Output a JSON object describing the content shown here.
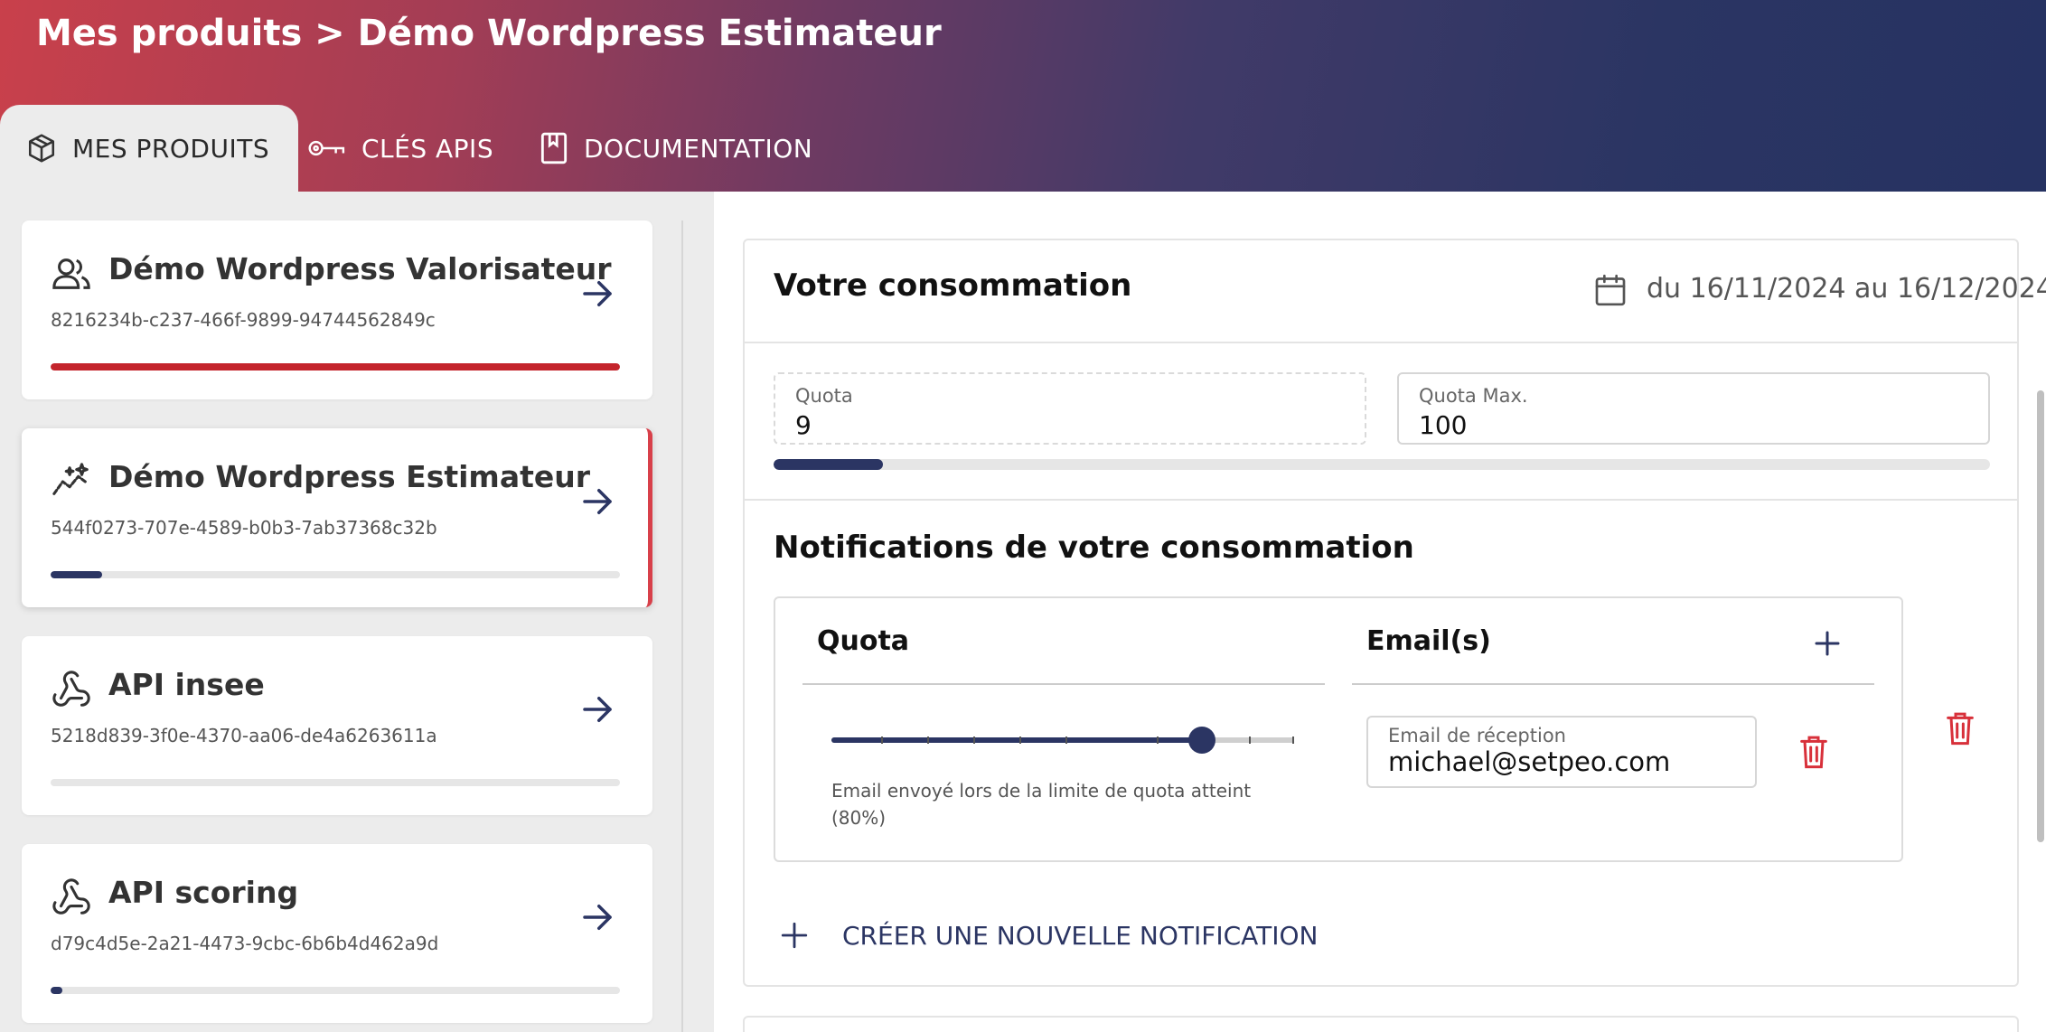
{
  "header": {
    "breadcrumb": "Mes produits > Démo Wordpress Estimateur"
  },
  "tabs": [
    {
      "label": "MES PRODUITS",
      "icon": "package-icon",
      "active": true
    },
    {
      "label": "CLÉS APIS",
      "icon": "key-icon",
      "active": false
    },
    {
      "label": "DOCUMENTATION",
      "icon": "book-icon",
      "active": false
    }
  ],
  "products": [
    {
      "name": "Démo Wordpress Valorisateur",
      "id": "8216234b-c237-466f-9899-94744562849c",
      "icon": "users-icon",
      "usage": 1.0,
      "bar_color": "#c4242c",
      "selected": false
    },
    {
      "name": "Démo Wordpress Estimateur",
      "id": "544f0273-707e-4589-b0b3-7ab37368c32b",
      "icon": "sparkle-chart-icon",
      "usage": 0.09,
      "bar_color": "#2b3563",
      "selected": true
    },
    {
      "name": "API insee",
      "id": "5218d839-3f0e-4370-aa06-de4a6263611a",
      "icon": "webhook-icon",
      "usage": 0,
      "bar_color": "#2b3563",
      "selected": false
    },
    {
      "name": "API scoring",
      "id": "d79c4d5e-2a21-4473-9cbc-6b6b4d462a9d",
      "icon": "webhook-icon",
      "usage": 0.02,
      "bar_color": "#2b3563",
      "selected": false
    }
  ],
  "consumption": {
    "title": "Votre consommation",
    "date_range": "du 16/11/2024 au 16/12/2024",
    "quota_label": "Quota",
    "quota_value": "9",
    "quota_max_label": "Quota Max.",
    "quota_max_value": "100",
    "usage_fraction": 0.09
  },
  "notifications": {
    "title": "Notifications de votre consommation",
    "col_quota": "Quota",
    "col_emails": "Email(s)",
    "rows": [
      {
        "threshold_percent": 80,
        "caption": "Email envoyé lors de la limite de quota atteint (80%)",
        "email_label": "Email de réception",
        "email_value": "michael@setpeo.com"
      }
    ],
    "create_label": "CRÉER UNE NOUVELLE NOTIFICATION"
  },
  "colors": {
    "accent": "#2b3563",
    "danger": "#d8303a",
    "brand_red": "#c9404b"
  }
}
